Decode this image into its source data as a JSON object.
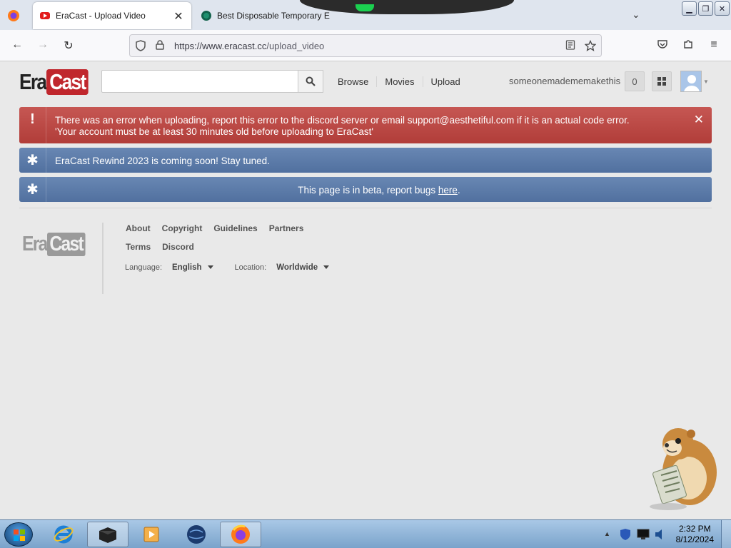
{
  "browser": {
    "tabs": [
      {
        "title": "EraCast - Upload Video",
        "active": true
      },
      {
        "title": "Best Disposable Temporary E",
        "active": false
      }
    ],
    "url": "https://www.eracast.cc/upload_video",
    "url_display_host": "https://www.eracast.cc",
    "url_display_path": "/upload_video"
  },
  "site": {
    "logo_era": "Era",
    "logo_cast": "Cast",
    "search_placeholder": "",
    "nav": [
      "Browse",
      "Movies",
      "Upload"
    ],
    "username": "someonemadememakethis",
    "notification_count": "0"
  },
  "alerts": {
    "error_line1": "There was an error when uploading, report this error to the discord server or email support@aesthetiful.com if it is an actual code error.",
    "error_line2": "'Your account must be at least 30 minutes old before uploading to EraCast'",
    "rewind": "EraCast Rewind 2023 is coming soon! Stay tuned.",
    "beta_prefix": "This page is in beta, report bugs ",
    "beta_link": "here",
    "beta_suffix": "."
  },
  "footer": {
    "links_row1": [
      "About",
      "Copyright",
      "Guidelines",
      "Partners"
    ],
    "links_row2": [
      "Terms",
      "Discord"
    ],
    "language_label": "Language:",
    "language_value": "English",
    "location_label": "Location:",
    "location_value": "Worldwide"
  },
  "taskbar": {
    "time": "2:32 PM",
    "date": "8/12/2024"
  },
  "colors": {
    "error": "#b9443f",
    "info": "#5b79a7",
    "brand": "#c0272d"
  }
}
